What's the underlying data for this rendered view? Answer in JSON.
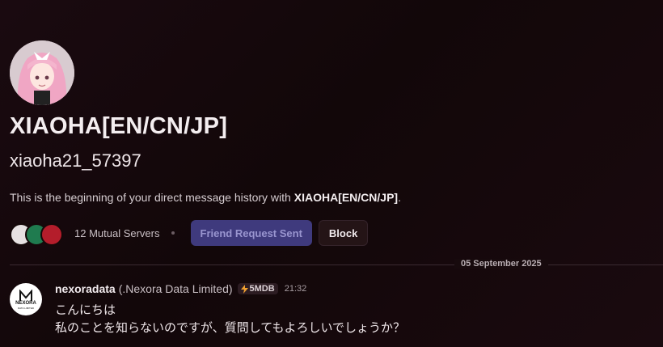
{
  "profile": {
    "display_name": "XIAOHA[EN/CN/JP]",
    "username": "xiaoha21_57397",
    "intro_prefix": "This is the beginning of your direct message history with ",
    "intro_name": "XIAOHA[EN/CN/JP]",
    "intro_suffix": "."
  },
  "actions": {
    "mutual_servers": "12 Mutual Servers",
    "friend_request_label": "Friend Request Sent",
    "block_label": "Block"
  },
  "divider": {
    "date": "05 September 2025"
  },
  "message": {
    "author": "nexoradata",
    "author_sub": "(.Nexora Data Limited)",
    "tag": "5MDB",
    "timestamp": "21:32",
    "lines": [
      "こんにちは",
      "私のことを知らないのですが、質問してもよろしいでしょうか？"
    ],
    "avatar_text": "NEXORA",
    "avatar_subtext": "DATA LIMITED"
  },
  "colors": {
    "friend_button_bg": "#3f3a7d",
    "tag_bolt": "#f0a030"
  }
}
